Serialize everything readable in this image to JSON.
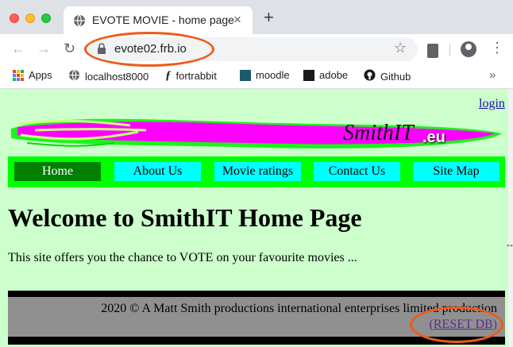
{
  "browser": {
    "tab_title": "EVOTE MOVIE - home page",
    "tab_close": "×",
    "new_tab": "+",
    "url": "evote02.frb.io",
    "nav": {
      "back": "←",
      "forward": "→",
      "reload": "↻"
    },
    "star": "☆",
    "menu": "⋮",
    "bookmarks": [
      {
        "label": "Apps",
        "icon": "apps-grid-icon"
      },
      {
        "label": "localhost8000",
        "icon": "globe-icon"
      },
      {
        "label": "fortrabbit",
        "icon": "fortrabbit-icon"
      },
      {
        "label": "moodle",
        "icon": "moodle-icon"
      },
      {
        "label": "adobe",
        "icon": "adobe-icon"
      },
      {
        "label": "Github",
        "icon": "github-icon"
      }
    ],
    "bookmarks_more": "»"
  },
  "page": {
    "login_link": "login",
    "banner": {
      "brand": "SmithIT",
      "suffix": ".eu"
    },
    "nav": [
      "Home",
      "About Us",
      "Movie ratings",
      "Contact Us",
      "Site Map"
    ],
    "active_nav": "Home",
    "heading": "Welcome to SmithIT Home Page",
    "intro": "This site offers you the chance to VOTE on your favourite movies ...",
    "footer": {
      "copyright": "2020 © A Matt Smith productions international enterprises limited production",
      "reset_link": "(RESET DB)"
    }
  },
  "colors": {
    "page_bg": "#ccffcc",
    "nav_bar": "#00ff00",
    "nav_item": "#00ffff",
    "nav_active": "#008000",
    "banner_magenta": "#ff00ff",
    "footer_bg": "#909090",
    "annotation": "#f05a1a"
  }
}
